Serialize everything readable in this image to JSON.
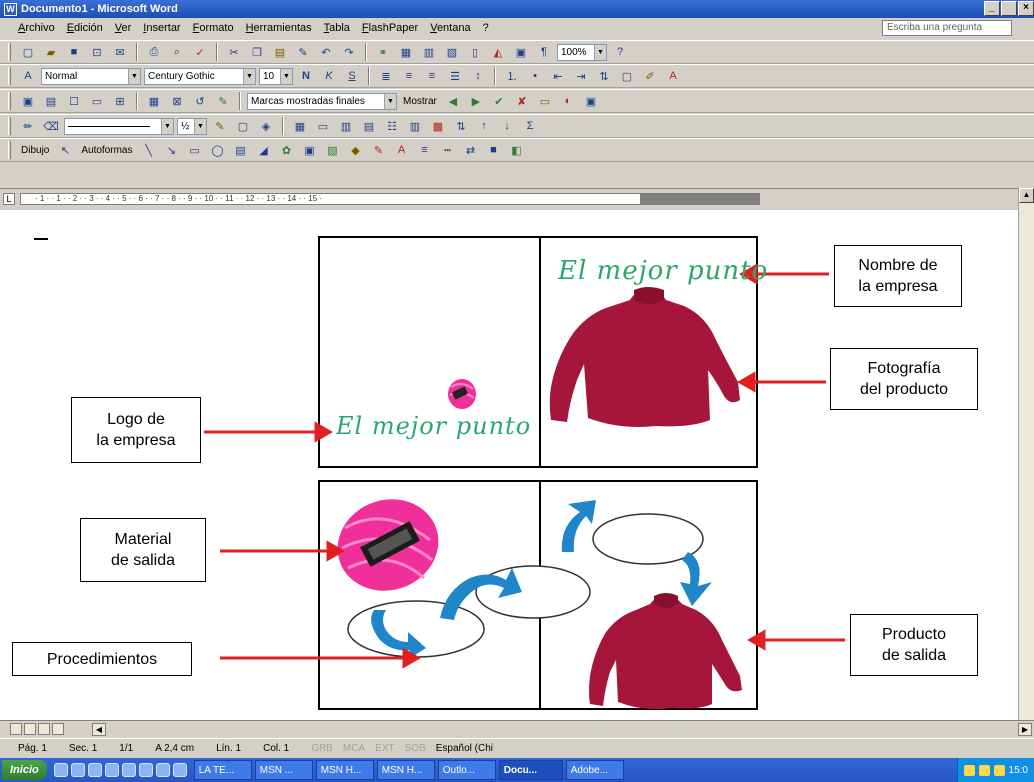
{
  "window": {
    "title": "Documento1 - Microsoft Word",
    "app_icon": "W",
    "controls": [
      "_",
      " ",
      "×"
    ]
  },
  "menubar": {
    "items": [
      "Archivo",
      "Edición",
      "Ver",
      "Insertar",
      "Formato",
      "Herramientas",
      "Tabla",
      "FlashPaper",
      "Ventana",
      "?"
    ],
    "ask_placeholder": "Escriba una pregunta"
  },
  "toolbars": {
    "standard_zoom": "100%",
    "style": "Normal",
    "font": "Century Gothic",
    "font_size": "10",
    "bold": "N",
    "italic": "K",
    "underline": "S",
    "review_markup": "Marcas mostradas finales",
    "review_show": "Mostrar",
    "drawing_label": "Dibujo",
    "autoshapes_label": "Autoformas"
  },
  "ruler": {
    "marks": "· 1 · · 1 · · 2 · · 3 · · 4 · · 5 · · 6 · · 7 · · 8 · · 9 · · 10 · · 11 · · 12 · · 13 · · 14 · · 15 ·"
  },
  "document": {
    "brand_name": "El mejor punto",
    "callouts": {
      "nombre": [
        "Nombre de",
        "la empresa"
      ],
      "foto": [
        "Fotografía",
        "del producto"
      ],
      "logo": [
        "Logo de",
        "la empresa"
      ],
      "material": [
        "Material",
        "de salida"
      ],
      "procedimientos": "Procedimientos",
      "producto": [
        "Producto",
        "de salida"
      ]
    },
    "colors": {
      "brand_green": "#2aa86a",
      "arrow_red": "#e02020",
      "flow_blue": "#1f86c9",
      "yarn_pink": "#f0309a",
      "sweater": "#a6163a"
    }
  },
  "statusbar": {
    "page": "Pág. 1",
    "section": "Sec. 1",
    "pages": "1/1",
    "at": "A 2,4 cm",
    "line": "Lín. 1",
    "col": "Col. 1",
    "grb": "GRB",
    "mca": "MCA",
    "ext": "EXT",
    "sob": "SOB",
    "language": "Español (Chi"
  },
  "taskbar": {
    "start": "Inicio",
    "buttons": [
      "LA TE...",
      "MSN ...",
      "MSN H...",
      "MSN H...",
      "Outlo...",
      "Docu...",
      "Adobe..."
    ],
    "clock": "15:0"
  }
}
